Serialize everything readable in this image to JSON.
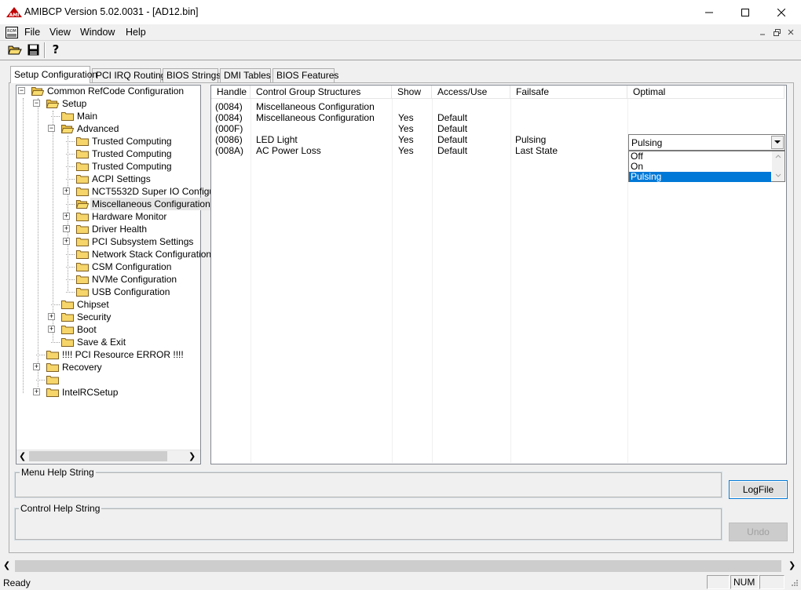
{
  "window": {
    "title": "AMIBCP Version 5.02.0031 - [AD12.bin]",
    "icon": "amibcp-app-icon",
    "controls": [
      "minimize-icon",
      "maximize-icon",
      "close-icon"
    ]
  },
  "menu": {
    "file": "File",
    "view": "View",
    "window": "Window",
    "help": "Help"
  },
  "toolbar": {
    "buttons": [
      "open-folder-icon",
      "save-disk-icon",
      "help-question-icon"
    ]
  },
  "tabs": {
    "setup": "Setup Configuration",
    "pci": "PCI IRQ Routing",
    "bios_strings": "BIOS Strings",
    "dmi": "DMI Tables",
    "bios_features": "BIOS Features"
  },
  "tree": {
    "root": "Common RefCode Configuration",
    "setup": "Setup",
    "main": "Main",
    "advanced": "Advanced",
    "trusted1": "Trusted Computing",
    "trusted2": "Trusted Computing",
    "trusted3": "Trusted Computing",
    "acpi": "ACPI Settings",
    "nct": "NCT5532D Super IO Configu",
    "misc": "Miscellaneous Configuration",
    "hwmon": "Hardware Monitor",
    "driver": "Driver Health",
    "pcisub": "PCI Subsystem Settings",
    "netstack": "Network Stack Configuration",
    "csm": "CSM Configuration",
    "nvme": "NVMe Configuration",
    "usb": "USB Configuration",
    "chipset": "Chipset",
    "security": "Security",
    "boot": "Boot",
    "saveexit": "Save & Exit",
    "pcierror": "!!!! PCI Resource ERROR !!!!",
    "recovery": "Recovery",
    "blank": "",
    "intelrc": "IntelRCSetup"
  },
  "grid": {
    "headers": {
      "handle": "Handle",
      "cgs": "Control Group Structures",
      "show": "Show",
      "access": "Access/Use",
      "failsafe": "Failsafe",
      "optimal": "Optimal"
    },
    "rows": [
      {
        "handle": "(0084)",
        "cgs": "Miscellaneous Configuration",
        "show": "",
        "access": "",
        "failsafe": "",
        "optimal": ""
      },
      {
        "handle": "(0084)",
        "cgs": "Miscellaneous Configuration",
        "show": "Yes",
        "access": "Default",
        "failsafe": "",
        "optimal": ""
      },
      {
        "handle": "(000F)",
        "cgs": "",
        "show": "Yes",
        "access": "Default",
        "failsafe": "",
        "optimal": ""
      },
      {
        "handle": "(0086)",
        "cgs": "LED Light",
        "show": "Yes",
        "access": "Default",
        "failsafe": "Pulsing",
        "optimal": ""
      },
      {
        "handle": "(008A)",
        "cgs": "AC Power Loss",
        "show": "Yes",
        "access": "Default",
        "failsafe": "Last State",
        "optimal": ""
      }
    ],
    "combo": {
      "value": "Pulsing",
      "options": [
        "Off",
        "On",
        "Pulsing"
      ],
      "selected_index": 2
    }
  },
  "help": {
    "menu_label": "Menu Help String",
    "control_label": "Control Help String"
  },
  "buttons": {
    "logfile": "LogFile",
    "undo": "Undo"
  },
  "status": {
    "text": "Ready",
    "num": "NUM"
  },
  "colors": {
    "selection": "#0078d7",
    "folder": "#f6d56a"
  }
}
